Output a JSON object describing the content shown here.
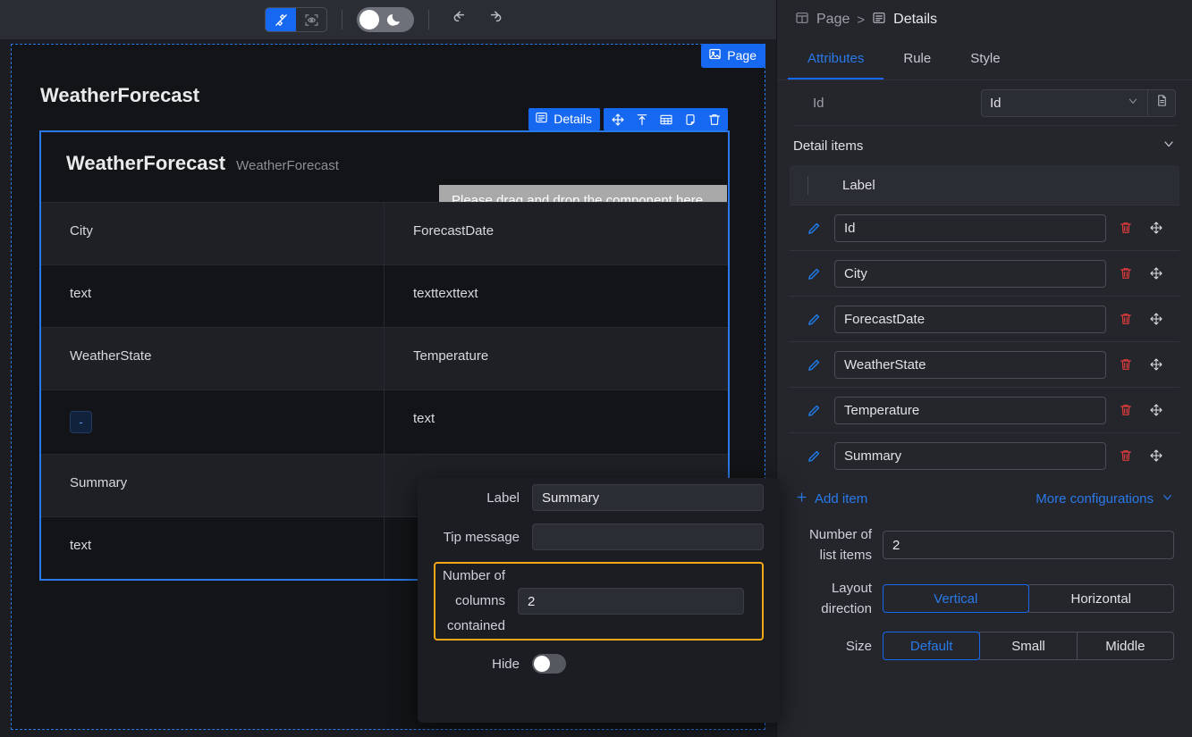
{
  "toolbar": {
    "design_icon": "design-tool-icon",
    "preview_icon": "preview-eye-icon",
    "theme_icon": "moon-icon",
    "undo_icon": "undo-icon",
    "redo_icon": "redo-icon"
  },
  "canvas": {
    "page_badge": "Page",
    "page_title": "WeatherForecast",
    "component": {
      "badge": "Details",
      "title": "WeatherForecast",
      "subtitle": "WeatherForecast",
      "drop_hint": "Please drag and drop the component here",
      "tools": [
        "move-icon",
        "insert-top-icon",
        "table-icon",
        "copy-icon",
        "delete-icon"
      ],
      "rows": [
        {
          "left": "City",
          "right": "ForecastDate",
          "left_type": "text"
        },
        {
          "left": "text",
          "right": "texttexttext",
          "left_type": "text"
        },
        {
          "left": "WeatherState",
          "right": "Temperature",
          "left_type": "text"
        },
        {
          "left": "-",
          "right": "text",
          "left_type": "badge"
        },
        {
          "left": "Summary",
          "right": "",
          "left_type": "text"
        },
        {
          "left": "text",
          "right": "",
          "left_type": "text"
        }
      ]
    }
  },
  "popup": {
    "label_label": "Label",
    "label_value": "Summary",
    "tip_label": "Tip message",
    "tip_value": "",
    "tip_placeholder": "",
    "columns_label": "Number of columns contained",
    "columns_value": "2",
    "hide_label": "Hide",
    "hide_on": false,
    "highlight_color": "#f0a818"
  },
  "panel": {
    "breadcrumb": {
      "root": "Page",
      "current": "Details",
      "separator": ">"
    },
    "tabs": [
      {
        "label": "Attributes",
        "active": true
      },
      {
        "label": "Rule",
        "active": false
      },
      {
        "label": "Style",
        "active": false
      }
    ],
    "id_field": {
      "label": "Id",
      "value": "Id",
      "dropdown_icon": "chevron-down-icon",
      "addon_icon": "document-icon"
    },
    "detail_items": {
      "section_title": "Detail items",
      "collapse_icon": "chevron-down-icon",
      "column_header": "Label",
      "rows": [
        {
          "value": "Id"
        },
        {
          "value": "City"
        },
        {
          "value": "ForecastDate"
        },
        {
          "value": "WeatherState"
        },
        {
          "value": "Temperature"
        },
        {
          "value": "Summary"
        }
      ],
      "add_item": "Add item",
      "more_configurations": "More configurations"
    },
    "config": {
      "list_items_label": "Number of list items",
      "list_items_value": "2",
      "layout_label": "Layout direction",
      "layout_options": [
        "Vertical",
        "Horizontal"
      ],
      "layout_selected": "Vertical",
      "size_label": "Size",
      "size_options": [
        "Default",
        "Small",
        "Middle"
      ],
      "size_selected": "Default"
    }
  },
  "colors": {
    "accent": "#1668f0",
    "accent_text": "#2a79e8",
    "danger": "#e23c3c",
    "highlight": "#f0a818"
  }
}
